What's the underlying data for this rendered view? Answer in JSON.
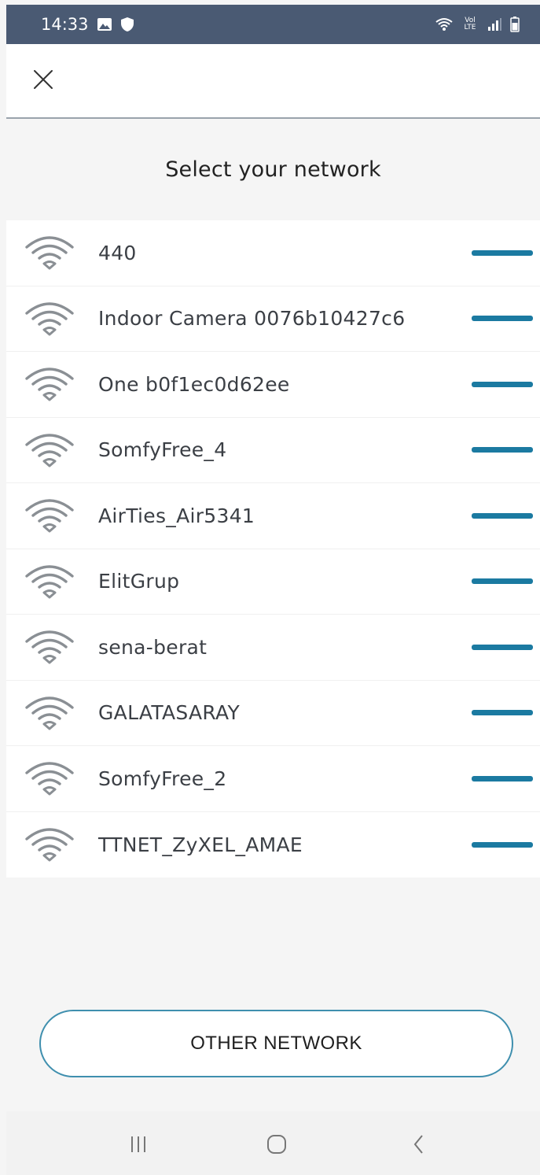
{
  "status_bar": {
    "time": "14:33",
    "left_icons": [
      "gallery-icon",
      "shield-icon"
    ],
    "right_icons": [
      "wifi-status-icon",
      "volte-icon",
      "cell-signal-icon",
      "battery-icon"
    ],
    "volte_text": "Vol LTE"
  },
  "header": {
    "close_icon": "close-icon"
  },
  "title": "Select your network",
  "networks": [
    {
      "name": "440"
    },
    {
      "name": "Indoor Camera 0076b10427c6"
    },
    {
      "name": "One b0f1ec0d62ee"
    },
    {
      "name": "SomfyFree_4"
    },
    {
      "name": "AirTies_Air5341"
    },
    {
      "name": "ElitGrup"
    },
    {
      "name": "sena-berat"
    },
    {
      "name": "GALATASARAY"
    },
    {
      "name": "SomfyFree_2"
    },
    {
      "name": "TTNET_ZyXEL_AMAE"
    }
  ],
  "other_button": "OTHER NETWORK",
  "nav": {
    "recents_icon": "recents-icon",
    "home_icon": "home-icon",
    "back_icon": "back-icon"
  },
  "colors": {
    "status_bar": "#4a5a73",
    "accent": "#1b7aa1",
    "button_border": "#3f8fae",
    "wifi_icon": "#8a8f94"
  }
}
